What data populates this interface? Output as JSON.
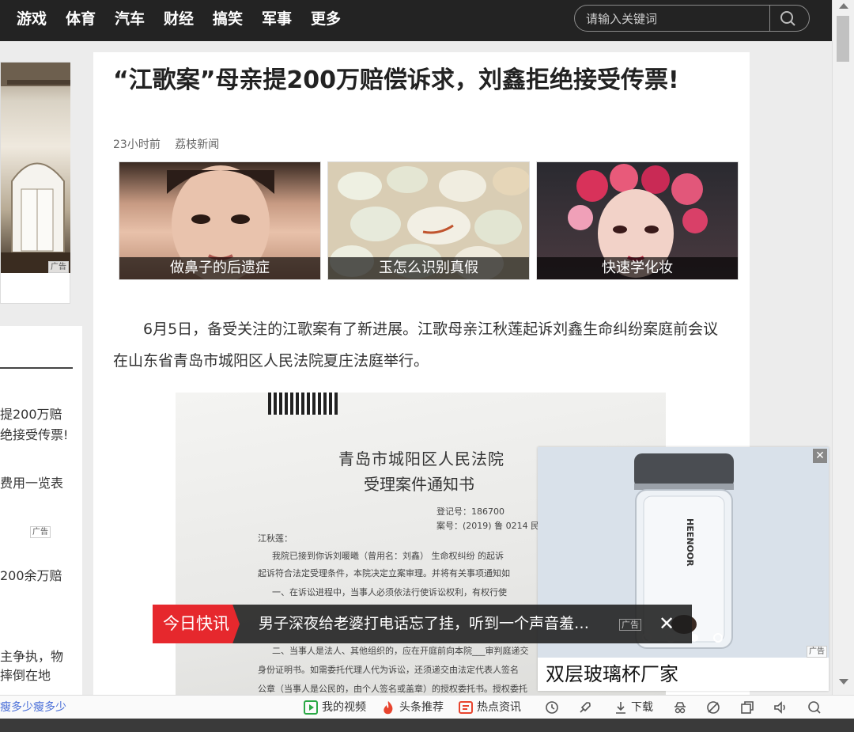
{
  "nav": {
    "items": [
      "游戏",
      "体育",
      "汽车",
      "财经",
      "搞笑",
      "军事",
      "更多"
    ],
    "search_placeholder": "请输入关键词"
  },
  "left": {
    "ad_badge": "广告",
    "ad_badge2": "广告",
    "texts": [
      "提200万赔",
      "绝接受传票!",
      "费用一览表",
      "200余万赔",
      "主争执，物",
      "摔倒在地"
    ],
    "bottom_link": "瘦多少瘦多少"
  },
  "article": {
    "title": "“江歌案”母亲提200万赔偿诉求，刘鑫拒绝接受传票!",
    "time": "23小时前",
    "source": "荔枝新闻",
    "thumbs": [
      "做鼻子的后遗症",
      "玉怎么识别真假",
      "快速学化妆"
    ],
    "paragraph": "6月5日，备受关注的江歌案有了新进展。江歌母亲江秋莲起诉刘鑫生命纠纷案庭前会议在山东省青岛市城阳区人民法院夏庄法庭举行。",
    "doc": {
      "court": "青岛市城阳区人民法院",
      "notice": "受理案件通知书",
      "reg_no": "登记号：186700",
      "case_no": "案号：(2019) 鲁 0214 民",
      "addressee": "江秋莲：",
      "line1": "我院已接到你诉刘暖曦（曾用名：刘鑫）  生命权纠纷  的起诉",
      "line2": "起诉符合法定受理条件，本院决定立案审理。并将有关事项通知如",
      "line3": "一、在诉讼进程中，当事人必须依法行使诉讼权利，有权行使",
      "line4": "二、当事人是法人、其他组织的，应在开庭前向本院___审判庭递交",
      "line5": "身份证明书。如需委托代理人代为诉讼，还须递交由法定代表人签名",
      "line6": "公章（当事人是公民的，由个人签名或盖章）的授权委托书。授权委托"
    }
  },
  "popup": {
    "brand": "HEENOOR",
    "caption": "双层玻璃杯厂家",
    "ad_badge": "广告",
    "close": "✕"
  },
  "ticker": {
    "label": "今日快讯",
    "text": "男子深夜给老婆打电话忘了挂，听到一个声音羞…",
    "ad": "广告",
    "close": "✕"
  },
  "bottombar": {
    "my_video": "我的视频",
    "toutiao": "头条推荐",
    "hot_news": "热点资讯",
    "download": "下载"
  },
  "colors": {
    "nav_bg": "#232323",
    "ticker_red": "#e6282d",
    "bottom_green": "#2aa845",
    "bottom_red": "#e8442e"
  }
}
